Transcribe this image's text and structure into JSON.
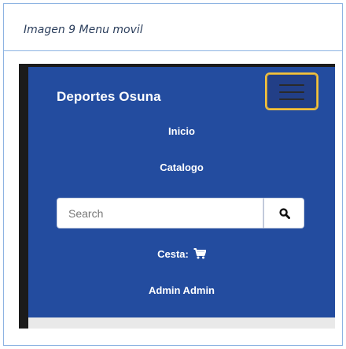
{
  "caption": "Imagen 9 Menu movil",
  "navbar": {
    "brand": "Deportes Osuna",
    "links": {
      "home": "Inicio",
      "catalog": "Catalogo"
    },
    "search": {
      "value": "",
      "placeholder": "Search"
    },
    "cart_label": "Cesta:",
    "user_label": "Admin Admin"
  },
  "colors": {
    "navbar_background": "#234c9f",
    "toggler_border": "#f0c040",
    "text": "#ffffff"
  },
  "icons": [
    "hamburger-icon",
    "search-icon",
    "cart-icon"
  ]
}
